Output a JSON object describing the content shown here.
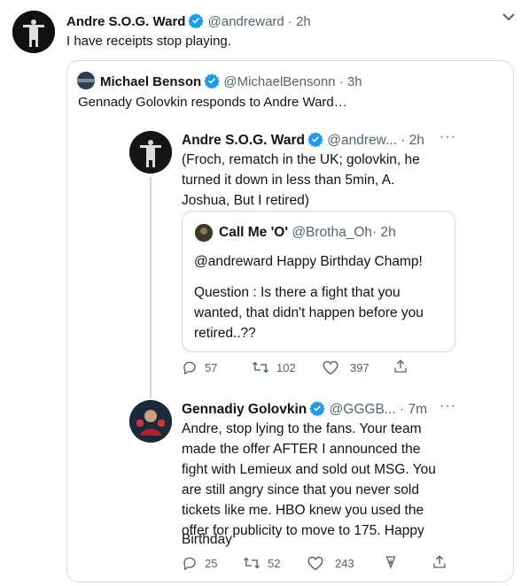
{
  "outer_tweet": {
    "name": "Andre S.O.G. Ward",
    "handle": "@andreward",
    "time": "· 2h",
    "text": "I have receipts stop playing."
  },
  "quote_tweet": {
    "name": "Michael Benson",
    "handle": "@MichaelBensonn",
    "time": "· 3h",
    "text": "Gennady Golovkin responds to Andre Ward…"
  },
  "thread_tweet_1": {
    "name": "Andre S.O.G. Ward",
    "handle": "@andrew...",
    "time": "· 2h",
    "more": "···",
    "lines": [
      "(Froch, rematch in the UK; golovkin, he",
      "turned it down in less than 5min, A.",
      "Joshua, But I retired)"
    ],
    "replies": "57",
    "retweets": "102",
    "likes": "397"
  },
  "inner_quote": {
    "name": "Call Me 'O'",
    "handle": "@Brotha_Oh",
    "time": "· 2h",
    "line1": "@andreward Happy Birthday Champ!",
    "lines": [
      "Question : Is there a fight that you",
      "wanted, that didn't happen before you",
      "retired..??"
    ]
  },
  "thread_tweet_2": {
    "name": "Gennadiy Golovkin",
    "handle": "@GGGB...",
    "time": "· 7m",
    "more": "···",
    "lines": [
      "Andre, stop lying to the fans. Your team",
      "made the offer AFTER I announced the",
      "fight with Lemieux and sold out MSG. You",
      "are still angry since that you never sold",
      "tickets like me. HBO knew you used the",
      "offer for publicity to move to 175. Happy",
      "Birthday"
    ],
    "replies": "25",
    "retweets": "52",
    "likes": "243"
  },
  "colors": {
    "verified": "#1d9bf0",
    "muted": "#536471",
    "border": "#cfd9de"
  }
}
